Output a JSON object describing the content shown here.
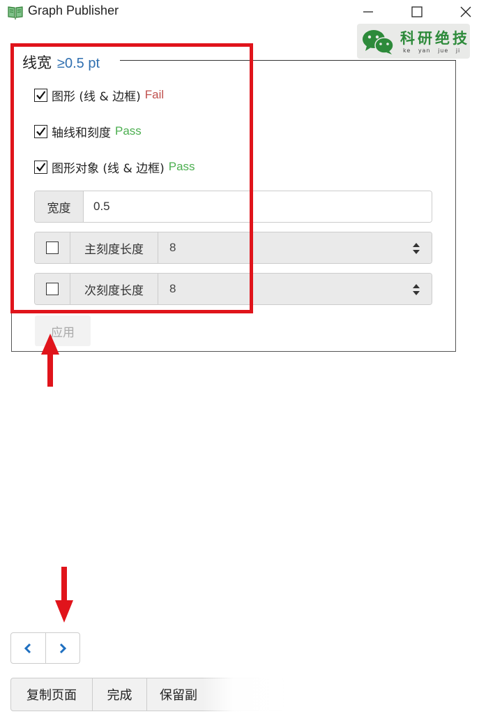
{
  "app": {
    "title": "Graph Publisher"
  },
  "watermark": {
    "main": "科研绝技",
    "sub": "ke yan jue ji"
  },
  "panel": {
    "legend_title": "线宽",
    "legend_value": "≥0.5 pt",
    "checks": [
      {
        "label": "图形 (线 & 边框)",
        "status": "Fail",
        "checked": true
      },
      {
        "label": "轴线和刻度",
        "status": "Pass",
        "checked": true
      },
      {
        "label": "图形对象 (线 & 边框)",
        "status": "Pass",
        "checked": true
      }
    ],
    "width": {
      "label": "宽度",
      "value": "0.5"
    },
    "major_tick": {
      "label": "主刻度长度",
      "value": "8",
      "checked": false
    },
    "minor_tick": {
      "label": "次刻度长度",
      "value": "8",
      "checked": false
    },
    "apply_label": "应用"
  },
  "bottom": {
    "copy_page": "复制页面",
    "done": "完成",
    "keep_copy": "保留副"
  },
  "colors": {
    "fail": "#c0504d",
    "pass": "#4caf50",
    "accent": "#2f6fb0",
    "annotation": "#e0141b",
    "watermark_green": "#2d8a3a"
  },
  "icons": {
    "app": "book-icon",
    "prev": "chevron-left-icon",
    "next": "chevron-right-icon",
    "select": "sort-icon"
  }
}
